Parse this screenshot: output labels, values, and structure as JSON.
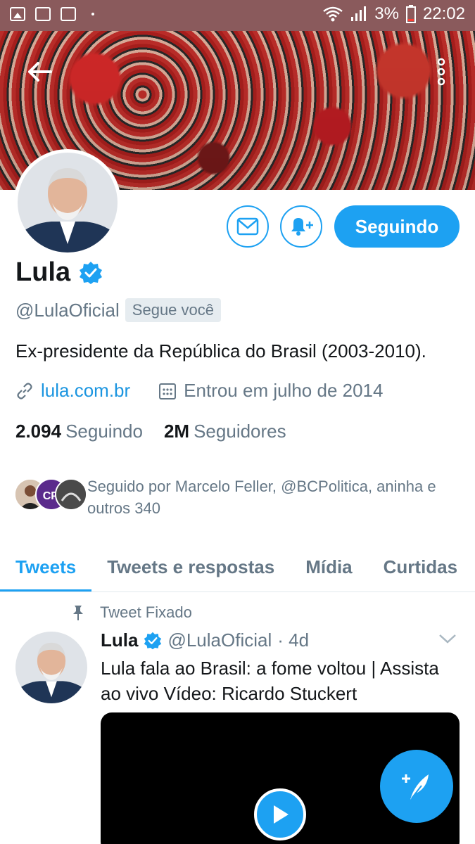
{
  "status_bar": {
    "battery": "3%",
    "time": "22:02"
  },
  "header": {
    "back_icon": "arrow-left-icon",
    "more_icon": "more-vertical-icon"
  },
  "profile": {
    "name": "Lula",
    "verified": true,
    "handle": "@LulaOficial",
    "follows_you": "Segue você",
    "bio": "Ex-presidente da República do Brasil (2003-2010).",
    "website": "lula.com.br",
    "joined": "Entrou em julho de 2014",
    "following_count": "2.094",
    "following_label": "Seguindo",
    "followers_count": "2M",
    "followers_label": "Seguidores",
    "followed_by": "Seguido por Marcelo Feller, @BCPolitica, aninha e outros 340",
    "mini_avatar_text": "CP."
  },
  "actions": {
    "message_icon": "envelope-icon",
    "notify_icon": "bell-plus-icon",
    "follow_button": "Seguindo"
  },
  "tabs": [
    {
      "label": "Tweets",
      "active": true
    },
    {
      "label": "Tweets e respostas",
      "active": false
    },
    {
      "label": "Mídia",
      "active": false
    },
    {
      "label": "Curtidas",
      "active": false
    }
  ],
  "tweet": {
    "pinned_label": "Tweet Fixado",
    "name": "Lula",
    "handle": "@LulaOficial",
    "time": "· 4d",
    "text": "Lula fala ao Brasil: a fome voltou | Assista ao vivo Vídeo: Ricardo Stuckert"
  },
  "colors": {
    "accent": "#1da1f2",
    "status_bar": "#8a5a5c",
    "secondary_text": "#657786"
  }
}
